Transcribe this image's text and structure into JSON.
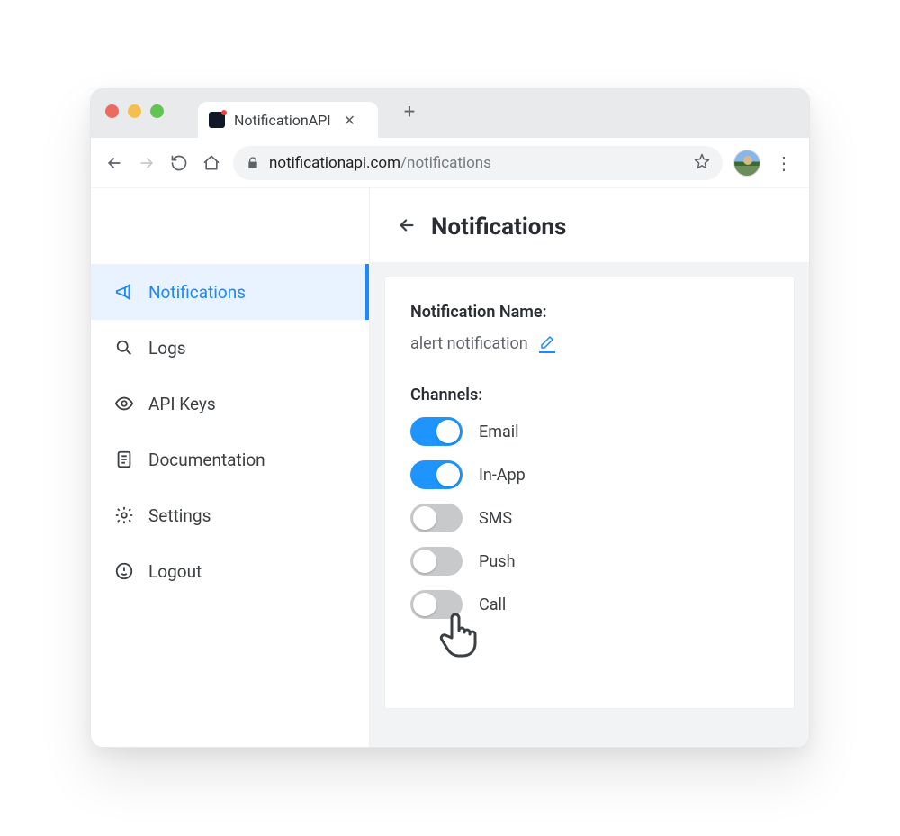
{
  "browser": {
    "tab_title": "NotificationAPI",
    "url_host": "notificationapi.com",
    "url_path": "/notifications"
  },
  "sidebar": {
    "items": [
      {
        "label": "Notifications",
        "icon": "megaphone-icon",
        "active": true
      },
      {
        "label": "Logs",
        "icon": "search-icon",
        "active": false
      },
      {
        "label": "API Keys",
        "icon": "eye-icon",
        "active": false
      },
      {
        "label": "Documentation",
        "icon": "document-icon",
        "active": false
      },
      {
        "label": "Settings",
        "icon": "gear-icon",
        "active": false
      },
      {
        "label": "Logout",
        "icon": "logout-icon",
        "active": false
      }
    ]
  },
  "page": {
    "title": "Notifications",
    "name_label": "Notification Name:",
    "name_value": "alert notification",
    "channels_label": "Channels:",
    "channels": [
      {
        "label": "Email",
        "on": true
      },
      {
        "label": "In-App",
        "on": true
      },
      {
        "label": "SMS",
        "on": false
      },
      {
        "label": "Push",
        "on": false
      },
      {
        "label": "Call",
        "on": false
      }
    ]
  }
}
